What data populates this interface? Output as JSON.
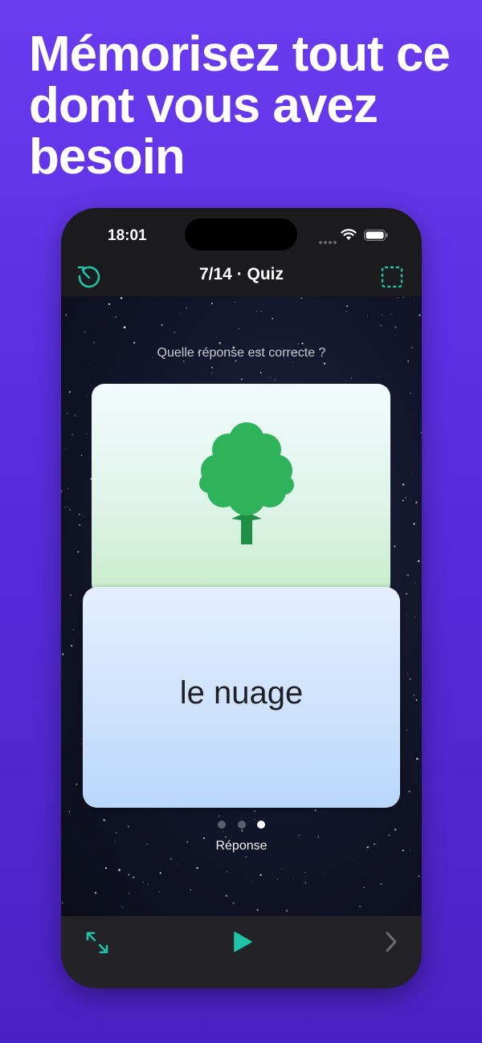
{
  "headline": "Mémorisez tout ce dont vous avez besoin",
  "status_bar": {
    "time": "18:01"
  },
  "nav": {
    "title": "7/14 · Quiz"
  },
  "quiz": {
    "question": "Quelle réponse est correcte ?",
    "answer": "le nuage",
    "page_label": "Réponse",
    "page_count": 3,
    "page_active": 3
  },
  "colors": {
    "accent": "#1fc3a8",
    "background": "#5a2fe0"
  },
  "icons": {
    "nav_left": "history-icon",
    "nav_right": "dashed-square-icon",
    "card_image": "tree-icon",
    "bottom_left": "expand-icon",
    "bottom_center": "play-icon",
    "bottom_right": "chevron-right-icon"
  }
}
